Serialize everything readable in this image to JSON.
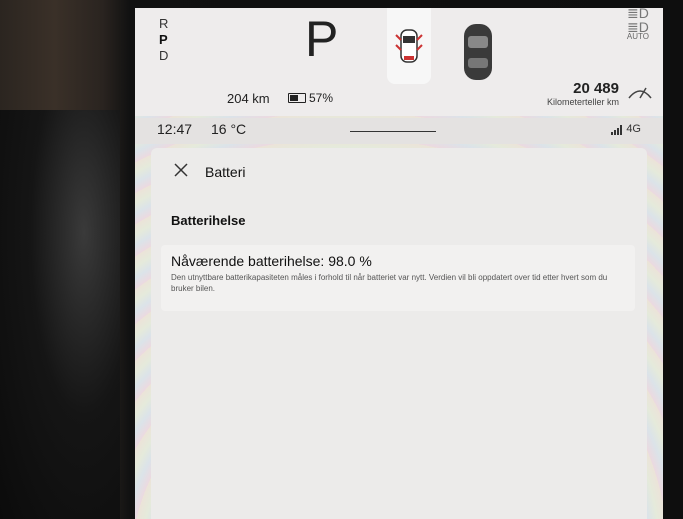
{
  "gear": {
    "r": "R",
    "p": "P",
    "d": "D",
    "current": "P"
  },
  "trip": {
    "range": "204 km",
    "battery_percent": "57%",
    "battery_level": 0.57
  },
  "odometer": {
    "value": "20 489",
    "label": "Kilometerteller km"
  },
  "lights": {
    "auto_label": "AUTO"
  },
  "status": {
    "time": "12:47",
    "temperature": "16 °C",
    "network": "4G"
  },
  "panel": {
    "title": "Batteri",
    "section_title": "Batterihelse",
    "health_title": "Nåværende batterihelse: 98.0 %",
    "health_description": "Den utnyttbare batterikapasiteten måles i forhold til når batteriet var nytt. Verdien vil bli oppdatert over tid etter hvert som du bruker bilen."
  }
}
